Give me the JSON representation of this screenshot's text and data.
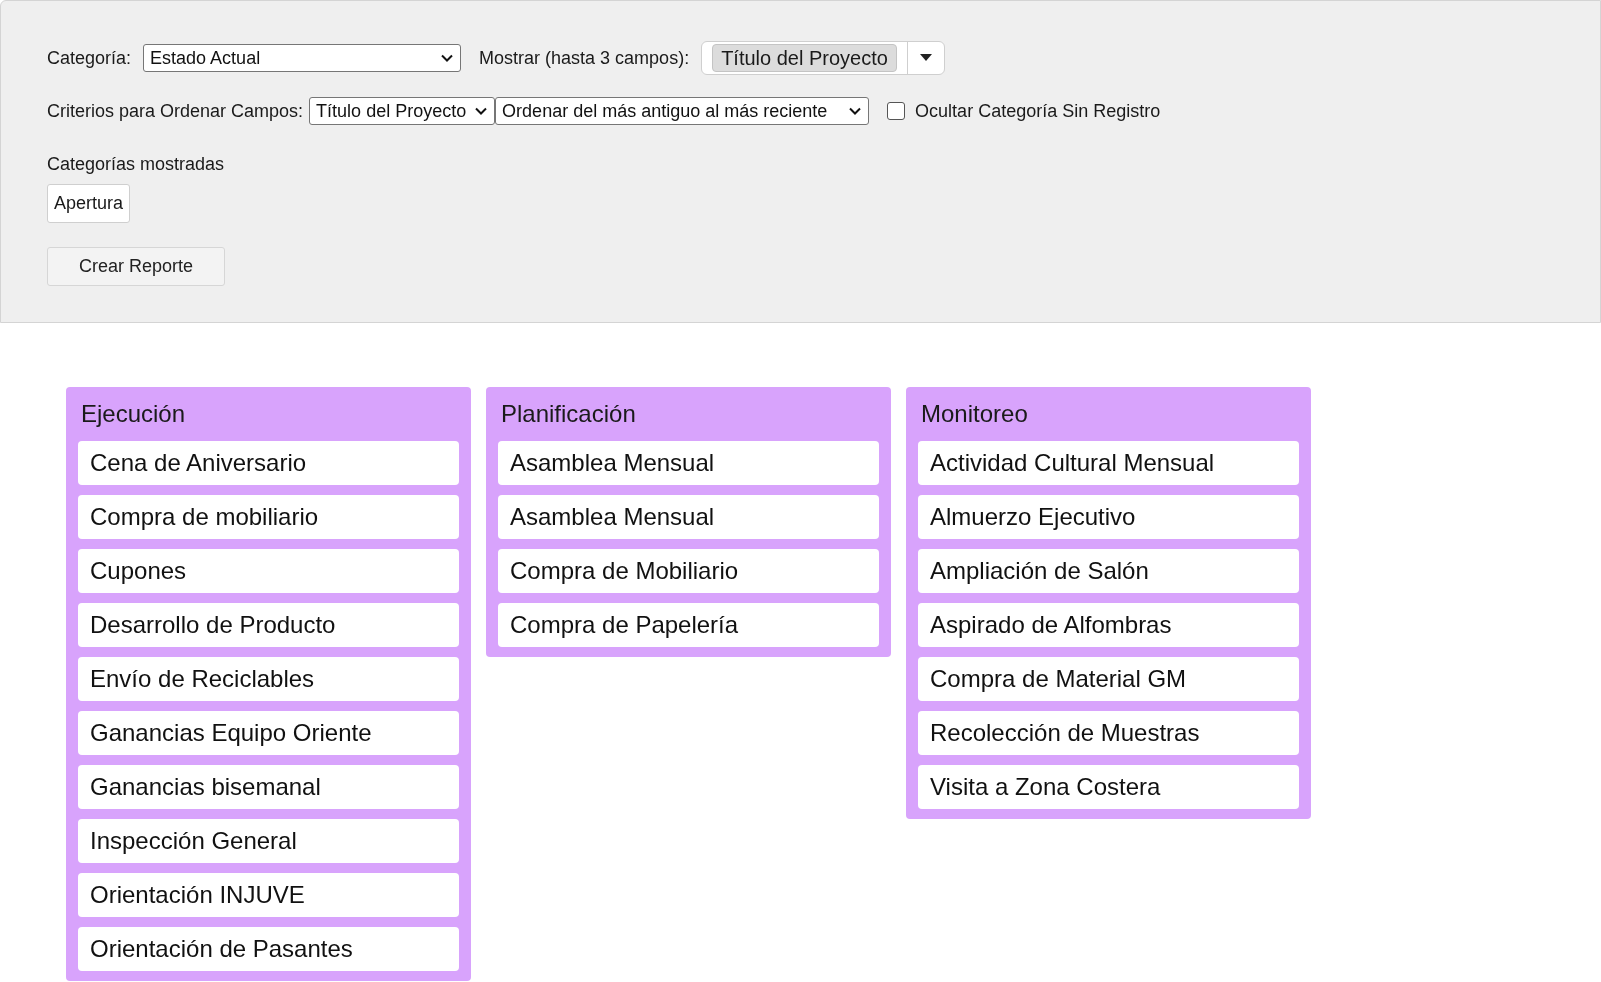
{
  "filters": {
    "category_label": "Categoría:",
    "category_value": "Estado Actual",
    "show_label": "Mostrar (hasta 3 campos):",
    "show_tags": [
      "Título del Proyecto"
    ],
    "sort_label": "Criterios para Ordenar Campos:",
    "sort_field": "Título del Proyecto",
    "sort_order": "Ordenar del más antiguo al más reciente",
    "hide_empty": {
      "label": "Ocultar Categoría Sin Registro",
      "checked": false
    },
    "shown_categories_label": "Categorías mostradas",
    "shown_categories": [
      "Apertura"
    ],
    "create_button": "Crear Reporte"
  },
  "columns": [
    {
      "title": "Ejecución",
      "color": "#d8a3fc",
      "cards": [
        "Cena de Aniversario",
        "Compra de mobiliario",
        "Cupones",
        "Desarrollo de Producto",
        "Envío de Reciclables",
        "Ganancias Equipo Oriente",
        "Ganancias bisemanal",
        "Inspección General",
        "Orientación INJUVE",
        "Orientación de Pasantes"
      ]
    },
    {
      "title": "Planificación",
      "color": "#d8a3fc",
      "cards": [
        "Asamblea Mensual",
        "Asamblea Mensual",
        "Compra de Mobiliario",
        "Compra de Papelería"
      ]
    },
    {
      "title": "Monitoreo",
      "color": "#d8a3fc",
      "cards": [
        "Actividad Cultural Mensual",
        "Almuerzo Ejecutivo",
        "Ampliación de Salón",
        "Aspirado de Alfombras",
        "Compra de Material GM",
        "Recolección de Muestras",
        "Visita a Zona Costera"
      ]
    }
  ]
}
